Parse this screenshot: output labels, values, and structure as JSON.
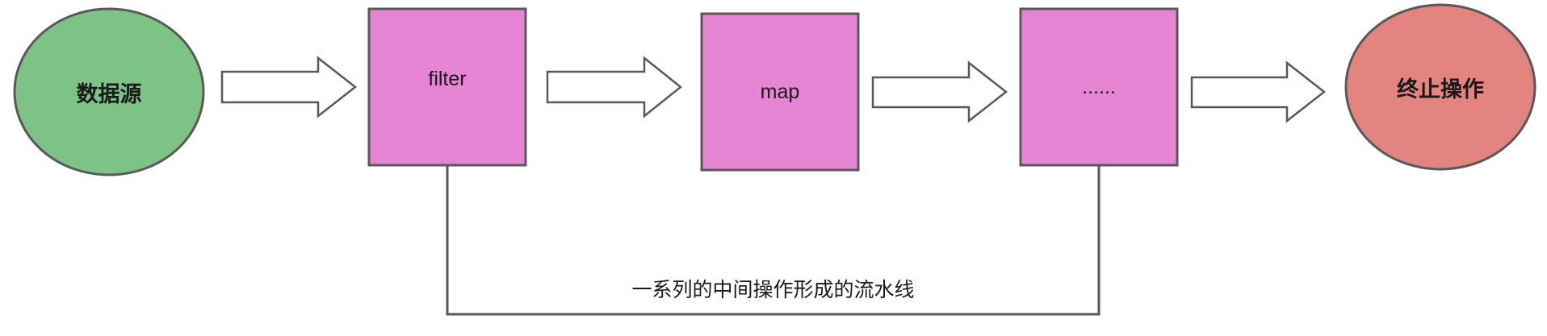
{
  "nodes": {
    "source": {
      "label": "数据源",
      "fill": "#7dc385"
    },
    "filter": {
      "label": "filter",
      "fill": "#e585d4"
    },
    "map": {
      "label": "map",
      "fill": "#e585d4"
    },
    "more": {
      "label": "......",
      "fill": "#e585d4"
    },
    "terminal": {
      "label": "终止操作",
      "fill": "#e38480"
    }
  },
  "pipeline_caption": "一系列的中间操作形成的流水线",
  "colors": {
    "stroke": "#595959",
    "arrow_fill": "#ffffff"
  }
}
